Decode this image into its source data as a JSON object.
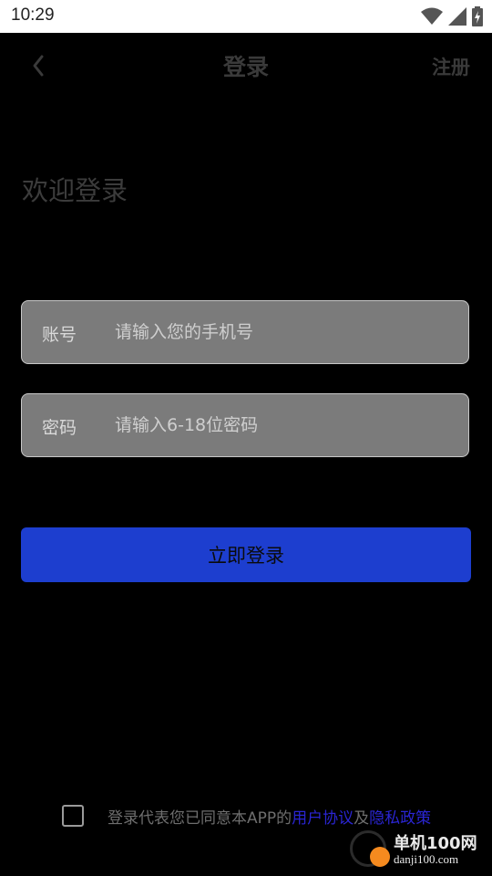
{
  "status_bar": {
    "time": "10:29"
  },
  "nav": {
    "title": "登录",
    "register_label": "注册"
  },
  "welcome_text": "欢迎登录",
  "form": {
    "account": {
      "label": "账号",
      "placeholder": "请输入您的手机号",
      "value": ""
    },
    "password": {
      "label": "密码",
      "placeholder": "请输入6-18位密码",
      "value": ""
    },
    "submit_label": "立即登录"
  },
  "agreement": {
    "checked": false,
    "prefix": "登录代表您已同意本APP的",
    "user_agreement": "用户协议",
    "conjunction": "及",
    "privacy_policy": "隐私政策"
  },
  "watermark": {
    "name": "单机100网",
    "url": "danji100.com"
  },
  "colors": {
    "accent": "#1d3ecf",
    "link": "#2a25d3",
    "background": "#000000"
  }
}
